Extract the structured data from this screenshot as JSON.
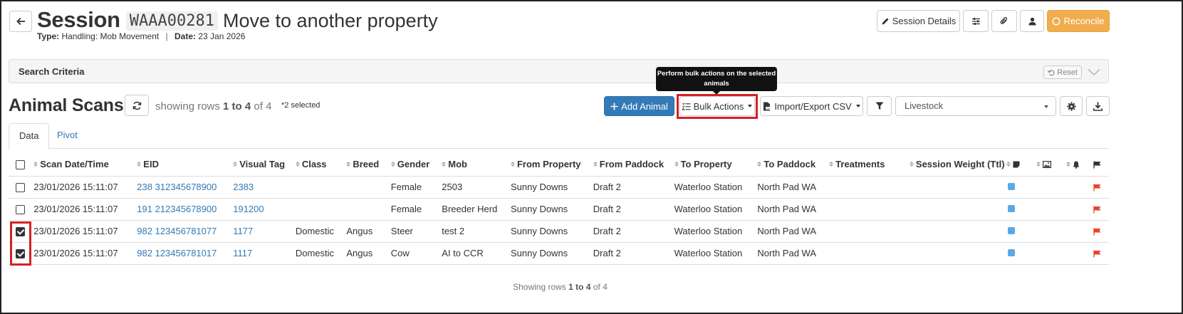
{
  "header": {
    "back_icon": "arrow-left-icon",
    "title_prefix": "Session",
    "session_code": "WAAA00281",
    "session_name": "Move to another property",
    "type_label": "Type:",
    "type_value": "Handling: Mob Movement",
    "date_label": "Date:",
    "date_value": "23 Jan 2026",
    "separator": "|",
    "session_details_label": "Session Details",
    "reconcile_label": "Reconcile",
    "reconcile_color": "#f0ad4e"
  },
  "search": {
    "title": "Search Criteria",
    "reset_label": "Reset"
  },
  "toolbar": {
    "section_title": "Animal Scans",
    "rows_prefix": "showing rows",
    "rows_range": "1 to 4",
    "rows_of": "of",
    "rows_total": "4",
    "selected_text": "*2 selected",
    "add_animal_label": "Add Animal",
    "bulk_actions_label": "Bulk Actions",
    "import_export_label": "Import/Export CSV",
    "livestock_select_value": "Livestock",
    "tooltip_text": "Perform bulk actions on the selected animals",
    "accent_color": "#337ab7",
    "highlight_color": "#d42027"
  },
  "tabs": [
    {
      "label": "Data",
      "active": true
    },
    {
      "label": "Pivot",
      "active": false
    }
  ],
  "table": {
    "columns": [
      "Scan Date/Time",
      "EID",
      "Visual Tag",
      "Class",
      "Breed",
      "Gender",
      "Mob",
      "From Property",
      "From Paddock",
      "To Property",
      "To Paddock",
      "Treatments",
      "Session Weight (Ttl)"
    ],
    "icon_columns": [
      "note-icon",
      "image-icon",
      "bell-icon",
      "flag-icon"
    ],
    "rows": [
      {
        "checked": false,
        "scan": "23/01/2026 15:11:07",
        "eid": "238 312345678900",
        "tag": "2383",
        "class": "",
        "breed": "",
        "gender": "Female",
        "mob": "2503",
        "from_property": "Sunny Downs",
        "from_paddock": "Draft 2",
        "to_property": "Waterloo Station",
        "to_paddock": "North Pad WA",
        "treatments": "",
        "weight": ""
      },
      {
        "checked": false,
        "scan": "23/01/2026 15:11:07",
        "eid": "191 212345678900",
        "tag": "191200",
        "class": "",
        "breed": "",
        "gender": "Female",
        "mob": "Breeder Herd",
        "from_property": "Sunny Downs",
        "from_paddock": "Draft 2",
        "to_property": "Waterloo Station",
        "to_paddock": "North Pad WA",
        "treatments": "",
        "weight": ""
      },
      {
        "checked": true,
        "scan": "23/01/2026 15:11:07",
        "eid": "982 123456781077",
        "tag": "1177",
        "class": "Domestic",
        "breed": "Angus",
        "gender": "Steer",
        "mob": "test 2",
        "from_property": "Sunny Downs",
        "from_paddock": "Draft 2",
        "to_property": "Waterloo Station",
        "to_paddock": "North Pad WA",
        "treatments": "",
        "weight": ""
      },
      {
        "checked": true,
        "scan": "23/01/2026 15:11:07",
        "eid": "982 123456781017",
        "tag": "1117",
        "class": "Domestic",
        "breed": "Angus",
        "gender": "Cow",
        "mob": "AI to CCR",
        "from_property": "Sunny Downs",
        "from_paddock": "Draft 2",
        "to_property": "Waterloo Station",
        "to_paddock": "North Pad WA",
        "treatments": "",
        "weight": ""
      }
    ]
  },
  "footer": {
    "prefix": "Showing rows",
    "range": "1 to 4",
    "of": "of",
    "total": "4"
  },
  "colors": {
    "note_icon": "#5aa9e6",
    "flag_icon": "#e8432d"
  }
}
